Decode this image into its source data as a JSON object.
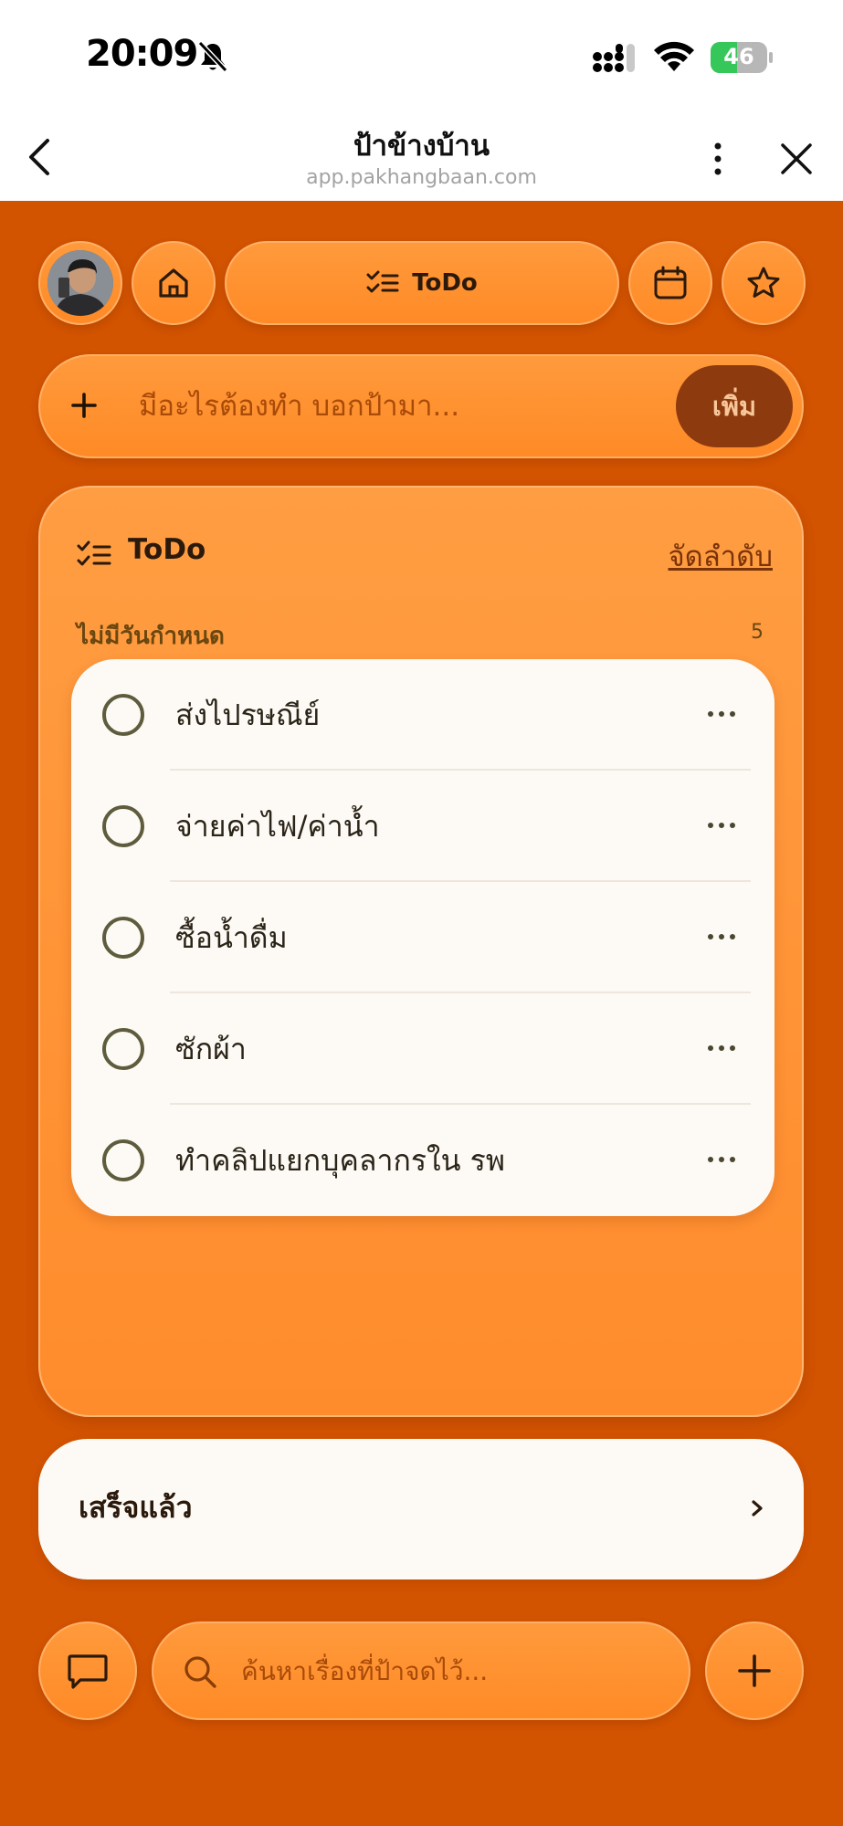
{
  "status_bar": {
    "time": "20:09",
    "battery_percent": "46",
    "battery_level": 0.46,
    "icons": [
      "bell-muted-icon",
      "signal-icon",
      "wifi-icon",
      "battery-charging-icon"
    ]
  },
  "browser": {
    "title": "ป้าข้างบ้าน",
    "url": "app.pakhangbaan.com",
    "icons": [
      "back-icon",
      "more-vertical-icon",
      "close-icon"
    ]
  },
  "top_nav": {
    "todo_label": "ToDo",
    "icons": [
      "avatar",
      "home-icon",
      "checklist-icon",
      "calendar-icon",
      "star-icon"
    ]
  },
  "add_bar": {
    "placeholder": "มีอะไรต้องทำ บอกป้ามา...",
    "value": "",
    "button_label": "เพิ่ม"
  },
  "todo_card": {
    "title": "ToDo",
    "sort_link": "จัดลำดับ",
    "section_label": "ไม่มีวันกำหนด",
    "section_count": "5",
    "tasks": [
      {
        "label": "ส่งไปรษณีย์",
        "done": false
      },
      {
        "label": "จ่ายค่าไฟ/ค่าน้ำ",
        "done": false
      },
      {
        "label": "ซื้อน้ำดื่ม",
        "done": false
      },
      {
        "label": "ซักผ้า",
        "done": false
      },
      {
        "label": "ทำคลิปแยกบุคลากรใน รพ",
        "done": false
      }
    ]
  },
  "done_section": {
    "label": "เสร็จแล้ว"
  },
  "bottom_bar": {
    "search_placeholder": "ค้นหาเรื่องที่ป้าจดไว้...",
    "icons": [
      "chat-icon",
      "search-icon",
      "plus-icon"
    ]
  },
  "colors": {
    "app_background": "#d35400",
    "button_orange": "#ff8a26",
    "add_button": "#8c3a0e",
    "card_white": "#fdfaf5",
    "checkbox_border": "#5e5c3d",
    "battery_green": "#35c759"
  }
}
